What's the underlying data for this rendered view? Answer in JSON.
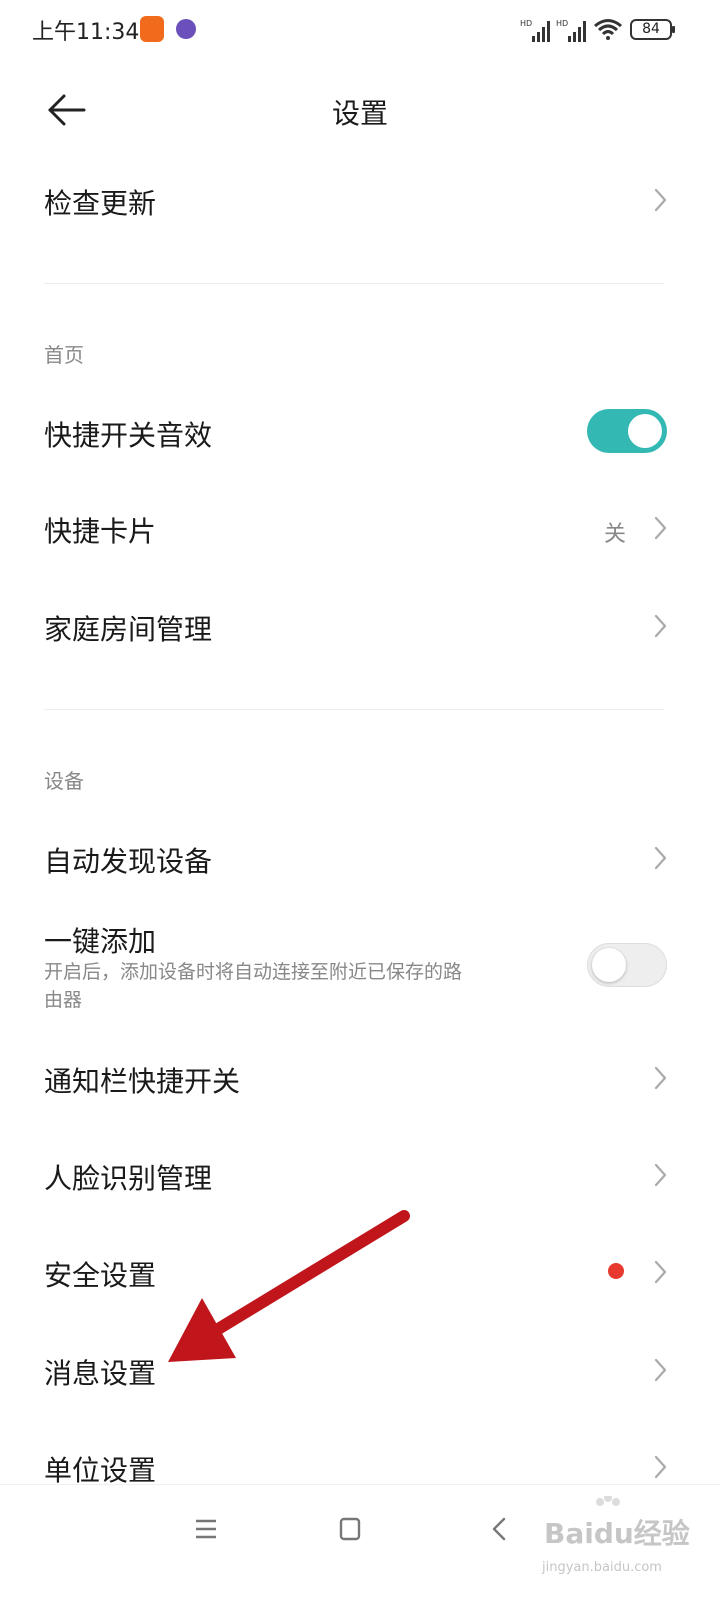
{
  "status_bar": {
    "time": "上午11:34",
    "battery": "84",
    "signal_1_label": "HD",
    "signal_2_label": "HD"
  },
  "header": {
    "title": "设置"
  },
  "rows": {
    "check_update": "检查更新",
    "quick_switch_sound": "快捷开关音效",
    "quick_card": "快捷卡片",
    "quick_card_value": "关",
    "family_room": "家庭房间管理",
    "auto_discover": "自动发现设备",
    "one_key_add": "一键添加",
    "one_key_add_desc": "开启后，添加设备时将自动连接至附近已保存的路由器",
    "notification_switch": "通知栏快捷开关",
    "face_recognition": "人脸识别管理",
    "security": "安全设置",
    "message": "消息设置",
    "unit": "单位设置"
  },
  "sections": {
    "home": "首页",
    "device": "设备"
  },
  "toggles": {
    "quick_switch_sound_on": true,
    "one_key_add_on": false
  },
  "watermark": {
    "brand": "Baidu经验",
    "url": "jingyan.baidu.com"
  },
  "colors": {
    "accent": "#33b8b3",
    "badge": "#e8392f",
    "annotation_arrow": "#c0161b"
  },
  "icons": {
    "back": "arrow-left-icon",
    "chevron": "chevron-right-icon",
    "nav_menu": "menu-icon",
    "nav_home": "square-home-icon",
    "nav_back": "chevron-left-icon"
  }
}
